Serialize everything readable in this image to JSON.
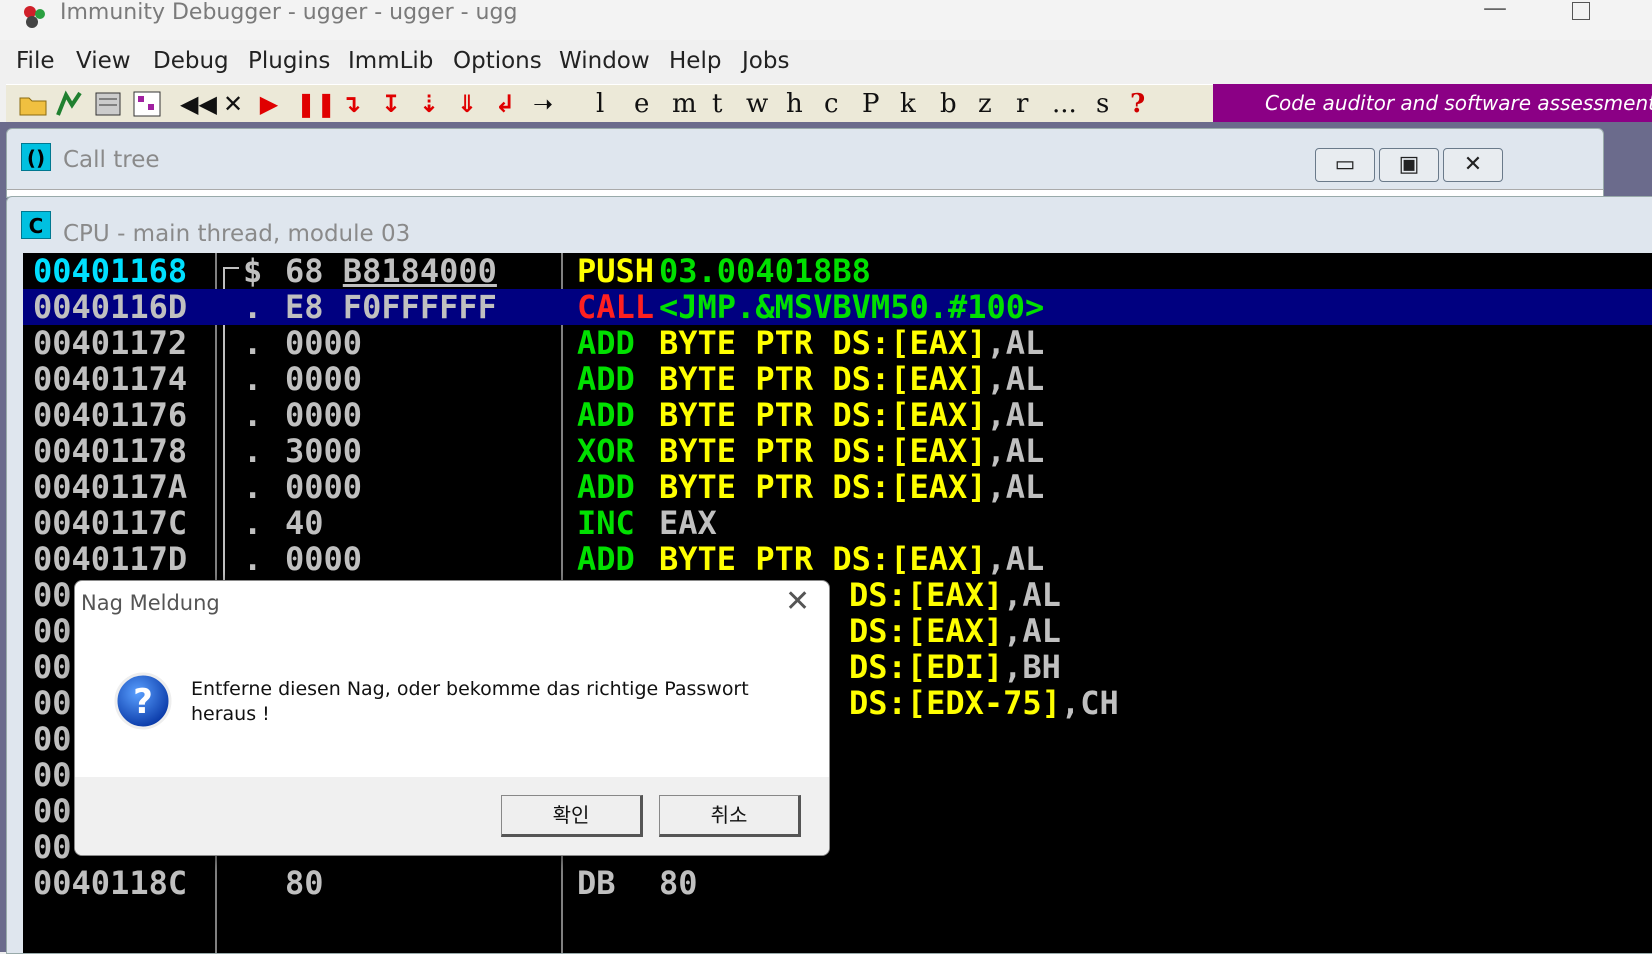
{
  "window": {
    "title": "Immunity Debugger - ugger - ugger - ugg",
    "min_glyph": "—"
  },
  "menu": [
    "File",
    "View",
    "Debug",
    "Plugins",
    "ImmLib",
    "Options",
    "Window",
    "Help",
    "Jobs"
  ],
  "toolbar": {
    "letters": [
      "l",
      "e",
      "m",
      "t",
      "w",
      "h",
      "c",
      "P",
      "k",
      "b",
      "z",
      "r",
      "...",
      "s",
      "?"
    ],
    "banner": "Code auditor and software assessment specialist needed"
  },
  "calltree": {
    "icon_text": "()",
    "title": "Call tree",
    "buttons": [
      "▭",
      "▣",
      "✕"
    ]
  },
  "cpu": {
    "icon_text": "C",
    "title": "CPU - main thread, module 03",
    "rows": [
      {
        "addr": "00401168",
        "mark": "$",
        "hex": "68 B8184000",
        "mn": "PUSH",
        "op": "03.004018B8"
      },
      {
        "addr": "0040116D",
        "mark": ".",
        "hex": "E8 F0FFFFFF",
        "mn": "CALL",
        "op": "<JMP.&MSVBVM50.#100>"
      },
      {
        "addr": "00401172",
        "mark": ".",
        "hex": "0000",
        "mn": "ADD",
        "op": "BYTE PTR DS:[EAX],AL"
      },
      {
        "addr": "00401174",
        "mark": ".",
        "hex": "0000",
        "mn": "ADD",
        "op": "BYTE PTR DS:[EAX],AL"
      },
      {
        "addr": "00401176",
        "mark": ".",
        "hex": "0000",
        "mn": "ADD",
        "op": "BYTE PTR DS:[EAX],AL"
      },
      {
        "addr": "00401178",
        "mark": ".",
        "hex": "3000",
        "mn": "XOR",
        "op": "BYTE PTR DS:[EAX],AL"
      },
      {
        "addr": "0040117A",
        "mark": ".",
        "hex": "0000",
        "mn": "ADD",
        "op": "BYTE PTR DS:[EAX],AL"
      },
      {
        "addr": "0040117C",
        "mark": ".",
        "hex": "40",
        "mn": "INC",
        "op": "EAX"
      },
      {
        "addr": "0040117D",
        "mark": ".",
        "hex": "0000",
        "mn": "ADD",
        "op": "BYTE PTR DS:[EAX],AL"
      },
      {
        "addr": "00",
        "mark": "",
        "hex": "",
        "mn": "",
        "op": "DS:[EAX],AL"
      },
      {
        "addr": "00",
        "mark": "",
        "hex": "",
        "mn": "",
        "op": "DS:[EAX],AL"
      },
      {
        "addr": "00",
        "mark": "",
        "hex": "",
        "mn": "",
        "op": "DS:[EDI],BH"
      },
      {
        "addr": "00",
        "mark": "",
        "hex": "",
        "mn": "",
        "op": "DS:[EDX-75],CH"
      },
      {
        "addr": "00",
        "mark": "",
        "hex": "",
        "mn": "",
        "op": ""
      },
      {
        "addr": "00",
        "mark": "",
        "hex": "",
        "mn": "",
        "op": ""
      },
      {
        "addr": "00",
        "mark": "",
        "hex": "",
        "mn": "",
        "op": ""
      },
      {
        "addr": "00",
        "mark": "",
        "hex": "",
        "mn": "",
        "op": ""
      },
      {
        "addr": "0040118C",
        "mark": "",
        "hex": "80",
        "mn": "DB",
        "op": "80"
      }
    ]
  },
  "dialog": {
    "title": "Nag Meldung",
    "close_glyph": "✕",
    "message": "Entferne diesen Nag, oder bekomme das richtige Passwort heraus !",
    "ok_label": "확인",
    "cancel_label": "취소"
  },
  "colors": {
    "accent": "#8b0085",
    "selection": "#000080",
    "mnemonic": "#00e000",
    "operand": "#ffff00"
  }
}
